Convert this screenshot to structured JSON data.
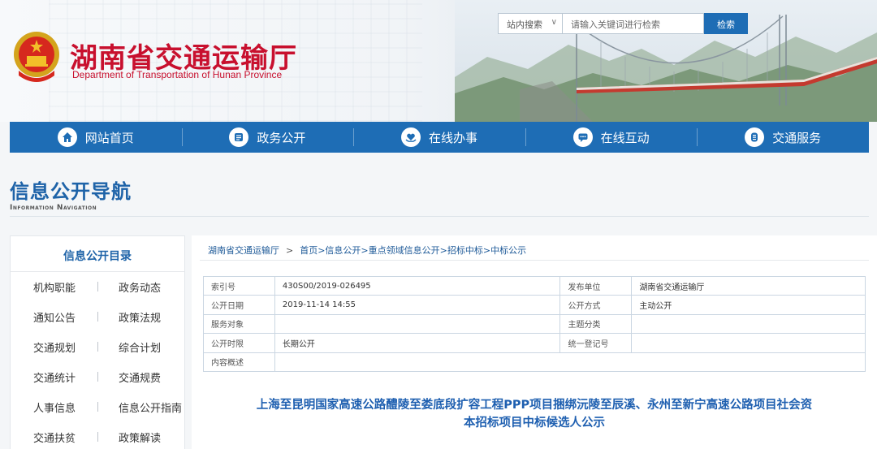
{
  "site": {
    "title_cn": "湖南省交通运输厅",
    "title_en": "Department of Transportation of Hunan Province"
  },
  "search": {
    "scope": "站内搜索",
    "placeholder": "请输入关键词进行检索",
    "button": "检索"
  },
  "nav": {
    "items": [
      {
        "label": "网站首页",
        "icon": "home-icon"
      },
      {
        "label": "政务公开",
        "icon": "document-icon"
      },
      {
        "label": "在线办事",
        "icon": "heart-hand-icon"
      },
      {
        "label": "在线互动",
        "icon": "chat-icon"
      },
      {
        "label": "交通服务",
        "icon": "service-icon"
      }
    ]
  },
  "section": {
    "title": "信息公开导航",
    "subtitle": "Information Navigation"
  },
  "sidebar": {
    "heading": "信息公开目录",
    "items": [
      "机构职能",
      "政务动态",
      "通知公告",
      "政策法规",
      "交通规划",
      "综合计划",
      "交通统计",
      "交通规费",
      "人事信息",
      "信息公开指南",
      "交通扶贫",
      "政策解读"
    ]
  },
  "breadcrumb": {
    "items": [
      "湖南省交通运输厅",
      "首页>信息公开>重点领域信息公开>招标中标>中标公示"
    ],
    "separator": ">"
  },
  "meta": {
    "rows": [
      {
        "k1": "索引号",
        "v1": "430S00/2019-026495",
        "k2": "发布单位",
        "v2": "湖南省交通运输厅"
      },
      {
        "k1": "公开日期",
        "v1": "2019-11-14 14:55",
        "k2": "公开方式",
        "v2": "主动公开"
      },
      {
        "k1": "服务对象",
        "v1": "",
        "k2": "主题分类",
        "v2": ""
      },
      {
        "k1": "公开时限",
        "v1": "长期公开",
        "k2": "统一登记号",
        "v2": ""
      },
      {
        "k1": "内容概述",
        "v1": ""
      }
    ]
  },
  "document": {
    "title_line1": "上海至昆明国家高速公路醴陵至娄底段扩容工程PPP项目捆绑沅陵至辰溪、永州至新宁高速公路项目社会资",
    "title_line2": "本招标项目中标候选人公示"
  },
  "colors": {
    "nav_blue": "#1e6db5",
    "brand_red": "#c8102e",
    "heading_blue": "#1e63a8"
  }
}
